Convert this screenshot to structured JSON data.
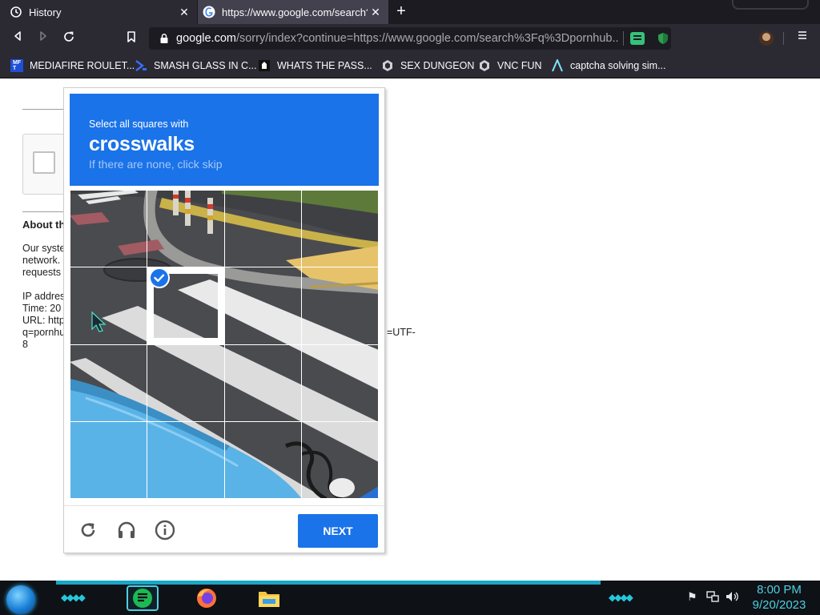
{
  "browser": {
    "tabs": [
      {
        "label": "History",
        "icon": "history-icon",
        "active": false
      },
      {
        "label": "https://www.google.com/search?q",
        "icon": "google-icon",
        "active": true
      }
    ],
    "url_host": "google.com",
    "url_rest": "/sorry/index?continue=https://www.google.com/search%3Fq%3Dpornhub...",
    "url_prefix": "",
    "bookmarks": [
      {
        "label": "MEDIAFIRE ROULET...",
        "icon": "mediafire-icon"
      },
      {
        "label": "SMASH GLASS IN C...",
        "icon": "smash-glass-icon"
      },
      {
        "label": "WHATS THE PASS...",
        "icon": "password-icon"
      },
      {
        "label": "SEX DUNGEON",
        "icon": "dungeon-icon"
      },
      {
        "label": "VNC FUN",
        "icon": "vnc-icon"
      },
      {
        "label": "captcha solving sim...",
        "icon": "captcha-sim-icon"
      }
    ]
  },
  "background_page": {
    "heading": "About th",
    "para1": [
      "Our syste",
      "network.",
      "requests"
    ],
    "info": [
      "IP addres",
      "Time: 20",
      "URL: http",
      "q=pornhu"
    ],
    "url_tail": [
      "=UTF-",
      "8"
    ]
  },
  "captcha": {
    "prompt": "Select all squares with",
    "keyword": "crosswalks",
    "subtext": "If there are none, click skip",
    "selected_cells": [
      [
        1,
        1
      ]
    ],
    "next_label": "NEXT",
    "colors": {
      "header": "#1a73e8",
      "button": "#1a73e8"
    }
  },
  "taskbar": {
    "time": "8:00 PM",
    "date": "9/20/2023",
    "apps": [
      "notes-app-icon",
      "firefox-icon",
      "file-explorer-icon"
    ]
  }
}
